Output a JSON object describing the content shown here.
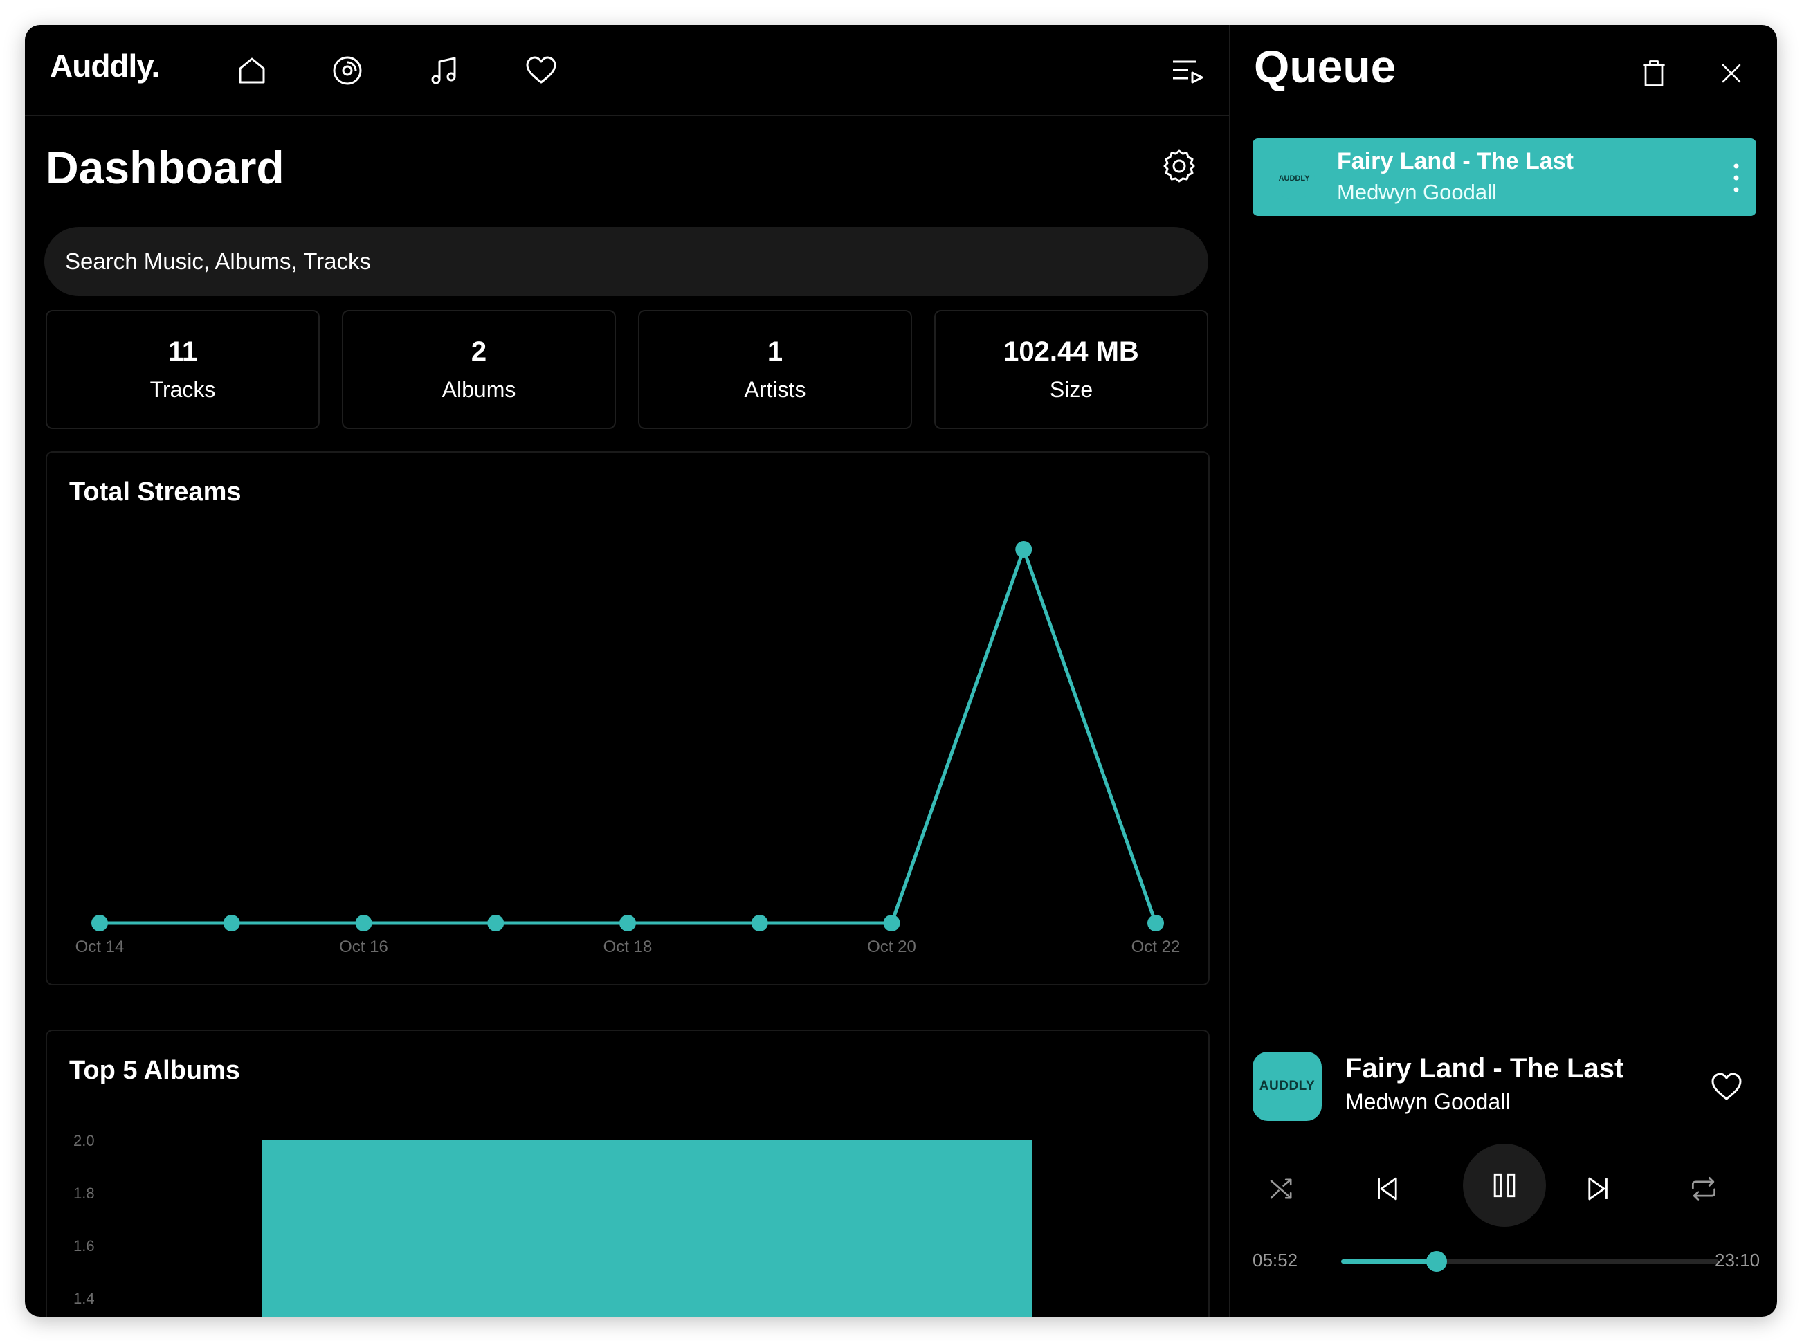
{
  "app": {
    "brand": "Auddly."
  },
  "nav": {
    "icons": [
      "home-icon",
      "disc-icon",
      "music-note-icon",
      "heart-icon",
      "queue-list-icon"
    ]
  },
  "dashboard": {
    "title": "Dashboard",
    "search_placeholder": "Search Music, Albums, Tracks",
    "stats": [
      {
        "value": "11",
        "label": "Tracks"
      },
      {
        "value": "2",
        "label": "Albums"
      },
      {
        "value": "1",
        "label": "Artists"
      },
      {
        "value": "102.44 MB",
        "label": "Size"
      }
    ]
  },
  "chart_data": [
    {
      "type": "line",
      "title": "Total Streams",
      "x": [
        "Oct 14",
        "Oct 15",
        "Oct 16",
        "Oct 17",
        "Oct 18",
        "Oct 19",
        "Oct 20",
        "Oct 21",
        "Oct 22"
      ],
      "tick_labels": [
        "Oct 14",
        "Oct 16",
        "Oct 18",
        "Oct 20",
        "Oct 22"
      ],
      "values": [
        0,
        0,
        0,
        0,
        0,
        0,
        0,
        1,
        0
      ],
      "ylim": [
        0,
        1
      ],
      "grid": false,
      "color": "#37bbb6"
    },
    {
      "type": "bar",
      "title": "Top 5 Albums",
      "categories": [
        ""
      ],
      "values": [
        2
      ],
      "ytick_labels": [
        "2.0",
        "1.8",
        "1.6",
        "1.4"
      ],
      "ylim": [
        0,
        2
      ],
      "color": "#37bbb6"
    }
  ],
  "queue": {
    "title": "Queue",
    "items": [
      {
        "title": "Fairy Land - The Last",
        "artist": "Medwyn Goodall",
        "art_text": "AUDDLY"
      }
    ]
  },
  "now_playing": {
    "title": "Fairy Land - The Last",
    "artist": "Medwyn Goodall",
    "art_text": "AUDDLY",
    "elapsed": "05:52",
    "duration": "23:10",
    "progress": 0.253
  },
  "colors": {
    "accent": "#37bbb6",
    "background": "#000000",
    "surface": "#1a1a1a"
  }
}
